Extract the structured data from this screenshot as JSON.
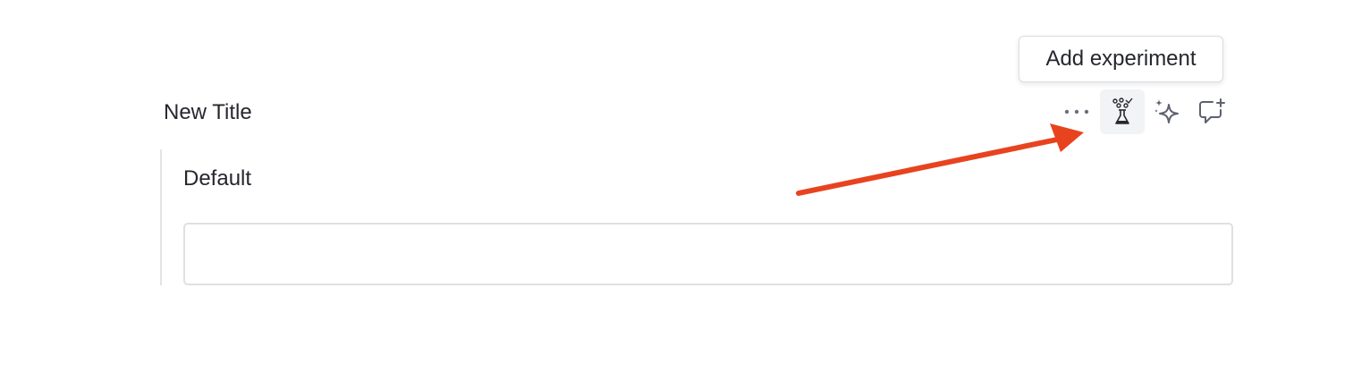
{
  "block": {
    "title": "New Title"
  },
  "toolbar": {
    "more_icon": "more-horizontal-icon",
    "experiment_icon": "flask-icon",
    "ai_icon": "sparkles-icon",
    "comment_icon": "add-comment-icon"
  },
  "tooltip": {
    "text": "Add experiment"
  },
  "variant": {
    "label": "Default",
    "value": "",
    "placeholder": ""
  },
  "colors": {
    "annotation_arrow": "#e8431f",
    "text": "#25272d",
    "icon": "#6b6f7b",
    "active_bg": "#f2f3f5"
  }
}
